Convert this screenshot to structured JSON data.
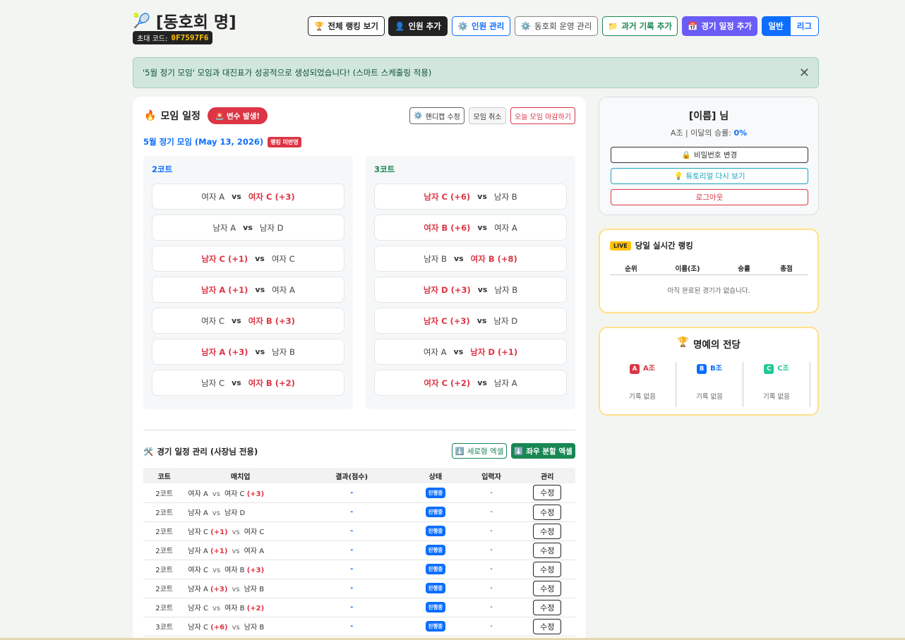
{
  "header": {
    "title": "[동호회 명]",
    "title_icon": "tennis-racket-icon",
    "invite_label": "초대 코드:",
    "invite_code": "0F7597F6",
    "buttons": {
      "ranking": "전체 랭킹 보기",
      "add_member": "인원 추가",
      "manage_member": "인원 관리",
      "club_manage": "동호회 운영 관리",
      "past_record": "과거 기록 추가",
      "add_schedule": "경기 일정 추가"
    },
    "mode_toggle": {
      "general": "일반",
      "league": "리그",
      "selected": "일반"
    }
  },
  "alert": {
    "text": "'5월 정기 모임' 모임과 대진표가 성공적으로 생성되었습니다! (스마트 스케줄링 적용)"
  },
  "schedule": {
    "title": "모임 일정",
    "event_badge": "변수 발생!",
    "handicap_button": "핸디캡 수정",
    "cancel_button": "모임 취소",
    "close_button": "오늘 모임 마감하기",
    "meeting_title": "5월 정기 모임 (May 13, 2026)",
    "rank_badge": "랭킹 미반영",
    "vs": "vs",
    "courts": [
      {
        "name": "2코트",
        "matches": [
          {
            "p1": "여자 A",
            "h1": "",
            "w1": false,
            "p2": "여자 C",
            "h2": "(+3)",
            "w2": true
          },
          {
            "p1": "남자 A",
            "h1": "",
            "w1": false,
            "p2": "남자 D",
            "h2": "",
            "w2": false
          },
          {
            "p1": "남자 C",
            "h1": "(+1)",
            "w1": true,
            "p2": "여자 C",
            "h2": "",
            "w2": false
          },
          {
            "p1": "남자 A",
            "h1": "(+1)",
            "w1": true,
            "p2": "여자 A",
            "h2": "",
            "w2": false
          },
          {
            "p1": "여자 C",
            "h1": "",
            "w1": false,
            "p2": "여자 B",
            "h2": "(+3)",
            "w2": true
          },
          {
            "p1": "남자 A",
            "h1": "(+3)",
            "w1": true,
            "p2": "남자 B",
            "h2": "",
            "w2": false
          },
          {
            "p1": "남자 C",
            "h1": "",
            "w1": false,
            "p2": "여자 B",
            "h2": "(+2)",
            "w2": true
          }
        ]
      },
      {
        "name": "3코트",
        "matches": [
          {
            "p1": "남자 C",
            "h1": "(+6)",
            "w1": true,
            "p2": "남자 B",
            "h2": "",
            "w2": false
          },
          {
            "p1": "여자 B",
            "h1": "(+6)",
            "w1": true,
            "p2": "여자 A",
            "h2": "",
            "w2": false
          },
          {
            "p1": "남자 B",
            "h1": "",
            "w1": false,
            "p2": "여자 B",
            "h2": "(+8)",
            "w2": true
          },
          {
            "p1": "남자 D",
            "h1": "(+3)",
            "w1": true,
            "p2": "남자 B",
            "h2": "",
            "w2": false
          },
          {
            "p1": "남자 C",
            "h1": "(+3)",
            "w1": true,
            "p2": "남자 D",
            "h2": "",
            "w2": false
          },
          {
            "p1": "여자 A",
            "h1": "",
            "w1": false,
            "p2": "남자 D",
            "h2": "(+1)",
            "w2": true
          },
          {
            "p1": "여자 C",
            "h1": "(+2)",
            "w1": true,
            "p2": "남자 A",
            "h2": "",
            "w2": false
          }
        ]
      }
    ]
  },
  "manager": {
    "title": "경기 일정 관리 (사장님 전용)",
    "excel_vertical": "세로형 엑셀",
    "excel_split": "좌우 분할 엑셀",
    "columns": [
      "코트",
      "매치업",
      "결과(점수)",
      "상태",
      "입력자",
      "관리"
    ],
    "rows": [
      {
        "court": "2코트",
        "p1": "여자 A",
        "h1": "",
        "p2": "여자 C",
        "h2": "(+3)",
        "result": "-",
        "status": "진행중",
        "inputter": "-",
        "action": "수정"
      },
      {
        "court": "2코트",
        "p1": "남자 A",
        "h1": "",
        "p2": "남자 D",
        "h2": "",
        "result": "-",
        "status": "진행중",
        "inputter": "-",
        "action": "수정"
      },
      {
        "court": "2코트",
        "p1": "남자 C",
        "h1": "(+1)",
        "p2": "여자 C",
        "h2": "",
        "result": "-",
        "status": "진행중",
        "inputter": "-",
        "action": "수정"
      },
      {
        "court": "2코트",
        "p1": "남자 A",
        "h1": "(+1)",
        "p2": "여자 A",
        "h2": "",
        "result": "-",
        "status": "진행중",
        "inputter": "-",
        "action": "수정"
      },
      {
        "court": "2코트",
        "p1": "여자 C",
        "h1": "",
        "p2": "여자 B",
        "h2": "(+3)",
        "result": "-",
        "status": "진행중",
        "inputter": "-",
        "action": "수정"
      },
      {
        "court": "2코트",
        "p1": "남자 A",
        "h1": "(+3)",
        "p2": "남자 B",
        "h2": "",
        "result": "-",
        "status": "진행중",
        "inputter": "-",
        "action": "수정"
      },
      {
        "court": "2코트",
        "p1": "남자 C",
        "h1": "",
        "p2": "여자 B",
        "h2": "(+2)",
        "result": "-",
        "status": "진행중",
        "inputter": "-",
        "action": "수정"
      },
      {
        "court": "3코트",
        "p1": "남자 C",
        "h1": "(+6)",
        "p2": "남자 B",
        "h2": "",
        "result": "-",
        "status": "진행중",
        "inputter": "-",
        "action": "수정"
      }
    ]
  },
  "profile": {
    "name": "[이름] 님",
    "group": "A조",
    "rate_label": "| 이달의 승률:",
    "rate": "0%",
    "pw_button": "비밀번호 변경",
    "tutorial_button": "튜토리얼 다시 보기",
    "logout_button": "로그아웃"
  },
  "live": {
    "badge": "LIVE",
    "title": "당일 실시간 랭킹",
    "columns": [
      "순위",
      "이름(조)",
      "승률",
      "총점"
    ],
    "empty": "아직 완료된 경기가 없습니다."
  },
  "hof": {
    "title": "명예의 전당",
    "groups": [
      {
        "letter": "A",
        "label": "A조",
        "color": "#dc3545",
        "empty": "기록 없음"
      },
      {
        "letter": "B",
        "label": "B조",
        "color": "#0d6efd",
        "empty": "기록 없음"
      },
      {
        "letter": "C",
        "label": "C조",
        "color": "#20c997",
        "empty": "기록 없음"
      }
    ]
  }
}
